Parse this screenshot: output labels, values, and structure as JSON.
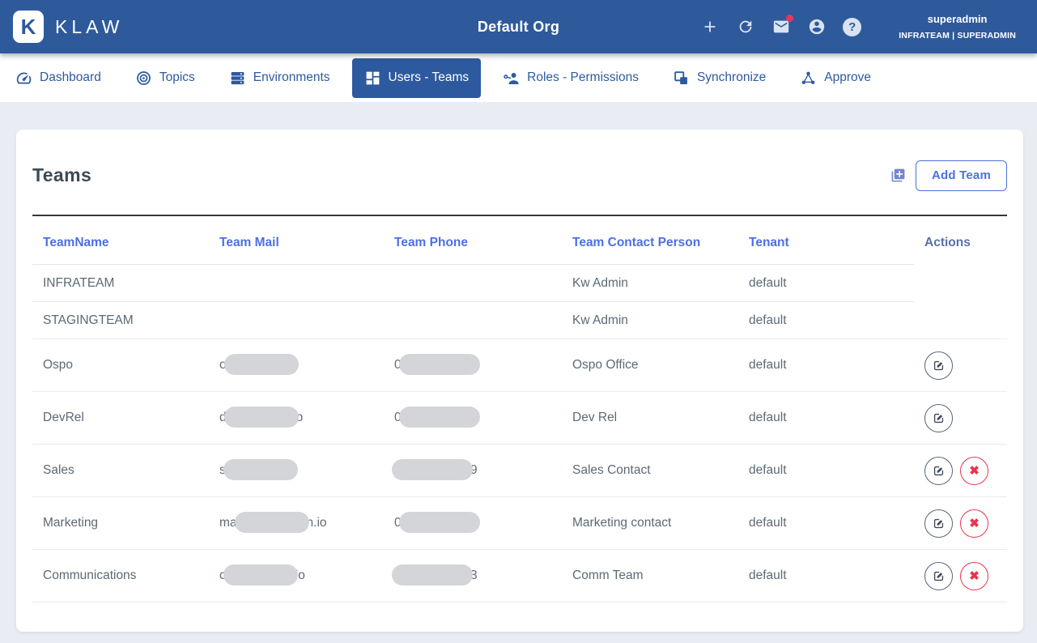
{
  "colors": {
    "header_bg": "#2e5a9c",
    "nav_active_bg": "#2d5a9e",
    "link_blue": "#4c70e0",
    "danger_red": "#e8344e",
    "redaction_gray": "#d3d5d8"
  },
  "header": {
    "logo_glyph": "K",
    "logo_text": "KLAW",
    "title": "Default Org",
    "icons": [
      {
        "name": "add-icon"
      },
      {
        "name": "refresh-icon"
      },
      {
        "name": "mail-icon",
        "badge": true
      },
      {
        "name": "account-icon"
      },
      {
        "name": "help-icon",
        "glyph": "?"
      }
    ],
    "user": {
      "name": "superadmin",
      "detail": "INFRATEAM | SUPERADMIN"
    }
  },
  "nav": {
    "items": [
      {
        "label": "Dashboard",
        "icon": "dashboard-icon",
        "active": false
      },
      {
        "label": "Topics",
        "icon": "topics-icon",
        "active": false
      },
      {
        "label": "Environments",
        "icon": "environments-icon",
        "active": false
      },
      {
        "label": "Users - Teams",
        "icon": "users-teams-icon",
        "active": true
      },
      {
        "label": "Roles - Permissions",
        "icon": "roles-permissions-icon",
        "active": false
      },
      {
        "label": "Synchronize",
        "icon": "synchronize-icon",
        "active": false
      },
      {
        "label": "Approve",
        "icon": "approve-icon",
        "active": false
      }
    ]
  },
  "page": {
    "heading": "Teams",
    "add_button_label": "Add Team",
    "add_button_icon": "library-add-icon"
  },
  "table": {
    "headers": [
      "TeamName",
      "Team Mail",
      "Team Phone",
      "Team Contact Person",
      "Tenant",
      "Actions"
    ],
    "rows": [
      {
        "name": "INFRATEAM",
        "mail": {
          "prefix": "",
          "redacted": false,
          "suffix": ""
        },
        "phone": {
          "prefix": "",
          "redacted": false,
          "suffix": ""
        },
        "contact": "Kw Admin",
        "tenant": "default",
        "actions": []
      },
      {
        "name": "STAGINGTEAM",
        "mail": {
          "prefix": "",
          "redacted": false,
          "suffix": ""
        },
        "phone": {
          "prefix": "",
          "redacted": false,
          "suffix": ""
        },
        "contact": "Kw Admin",
        "tenant": "default",
        "actions": []
      },
      {
        "name": "Ospo",
        "mail": {
          "prefix": "o",
          "redacted": true,
          "suffix": ""
        },
        "phone": {
          "prefix": "0",
          "redacted": true,
          "suffix": ""
        },
        "contact": "Ospo Office",
        "tenant": "default",
        "actions": [
          "edit"
        ]
      },
      {
        "name": "DevRel",
        "mail": {
          "prefix": "d",
          "redacted": true,
          "suffix": "o"
        },
        "phone": {
          "prefix": "0",
          "redacted": true,
          "suffix": ""
        },
        "contact": "Dev Rel",
        "tenant": "default",
        "actions": [
          "edit"
        ]
      },
      {
        "name": "Sales",
        "mail": {
          "prefix": "s",
          "redacted": true,
          "suffix": ""
        },
        "phone": {
          "prefix": "",
          "redacted": true,
          "suffix": "9"
        },
        "contact": "Sales Contact",
        "tenant": "default",
        "actions": [
          "edit",
          "delete"
        ]
      },
      {
        "name": "Marketing",
        "mail": {
          "prefix": "ma",
          "redacted": true,
          "suffix": "n.io"
        },
        "phone": {
          "prefix": "0",
          "redacted": true,
          "suffix": ""
        },
        "contact": "Marketing contact",
        "tenant": "default",
        "actions": [
          "edit",
          "delete"
        ]
      },
      {
        "name": "Communications",
        "mail": {
          "prefix": "c",
          "redacted": true,
          "suffix": "io"
        },
        "phone": {
          "prefix": "",
          "redacted": true,
          "suffix": "3"
        },
        "contact": "Comm Team",
        "tenant": "default",
        "actions": [
          "edit",
          "delete"
        ]
      }
    ]
  }
}
